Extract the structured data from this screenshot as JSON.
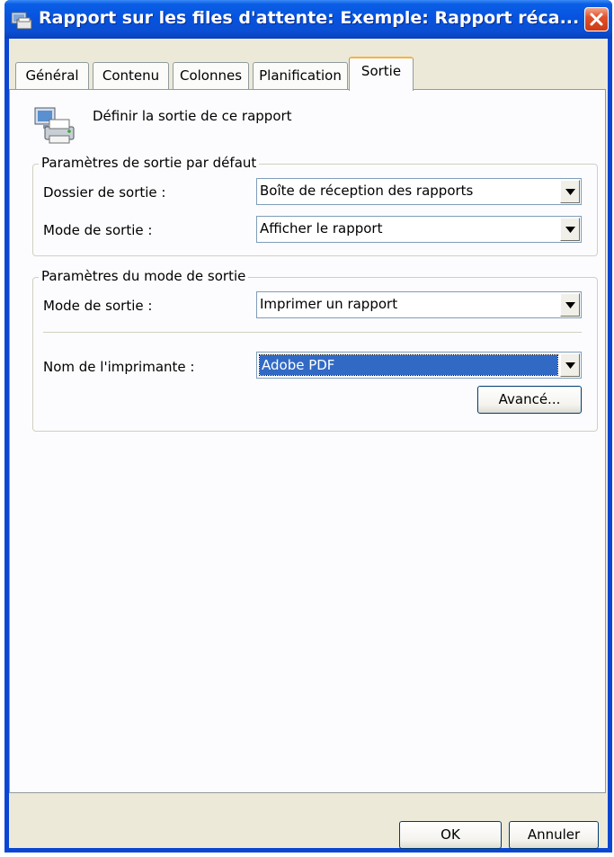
{
  "window": {
    "title": "Rapport sur les files d'attente: Exemple: Rapport réca..."
  },
  "tabs": [
    {
      "label": "Général"
    },
    {
      "label": "Contenu"
    },
    {
      "label": "Colonnes"
    },
    {
      "label": "Planification"
    },
    {
      "label": "Sortie"
    }
  ],
  "page": {
    "description": "Définir la sortie de ce rapport"
  },
  "default_group": {
    "legend": "Paramètres de sortie par défaut",
    "folder_label": "Dossier de sortie :",
    "folder_value": "Boîte de réception des rapports",
    "mode_label": "Mode de sortie :",
    "mode_value": "Afficher le rapport"
  },
  "mode_group": {
    "legend": "Paramètres du mode de sortie",
    "mode_label": "Mode de sortie :",
    "mode_value": "Imprimer un rapport",
    "printer_label": "Nom de l'imprimante :",
    "printer_value": "Adobe PDF",
    "advanced_label": "Avancé..."
  },
  "footer": {
    "ok_label": "OK",
    "cancel_label": "Annuler"
  }
}
